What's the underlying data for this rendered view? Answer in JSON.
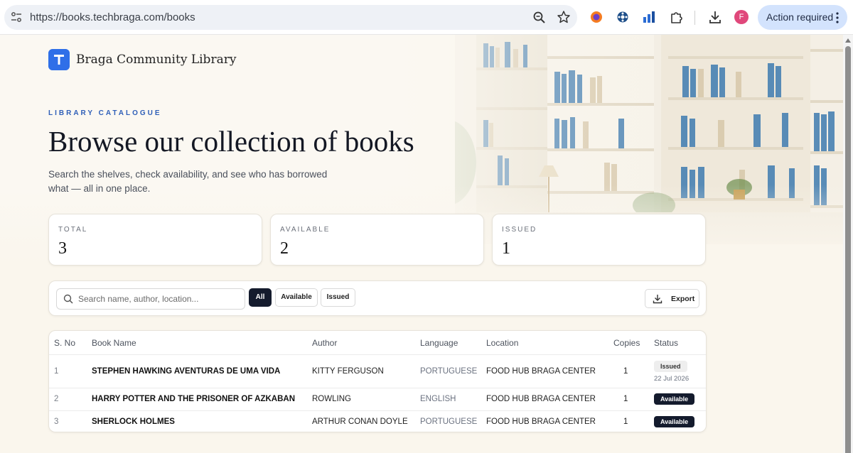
{
  "browser": {
    "url": "https://books.techbraga.com/books",
    "action_required": "Action required",
    "profile_initial": "F"
  },
  "brand": {
    "name": "Braga Community Library"
  },
  "hero": {
    "eyebrow": "LIBRARY CATALOGUE",
    "title": "Browse our collection of books",
    "subtitle": "Search the shelves, check availability, and see who has borrowed what — all in one place."
  },
  "stats": [
    {
      "label": "TOTAL",
      "value": "3"
    },
    {
      "label": "AVAILABLE",
      "value": "2"
    },
    {
      "label": "ISSUED",
      "value": "1"
    }
  ],
  "toolbar": {
    "search_placeholder": "Search name, author, location...",
    "filters": [
      "All",
      "Available",
      "Issued"
    ],
    "active_filter": "All",
    "export_label": "Export"
  },
  "table": {
    "headers": [
      "S. No",
      "Book Name",
      "Author",
      "Language",
      "Location",
      "Copies",
      "Status"
    ],
    "rows": [
      {
        "sno": "1",
        "book": "STEPHEN HAWKING AVENTURAS DE UMA VIDA",
        "author": "KITTY FERGUSON",
        "language": "PORTUGUESE",
        "location": "FOOD HUB BRAGA CENTER",
        "copies": "1",
        "status": "Issued",
        "date": "22 Jul 2026"
      },
      {
        "sno": "2",
        "book": "HARRY POTTER AND THE PRISONER OF AZKABAN",
        "author": "ROWLING",
        "language": "ENGLISH",
        "location": "FOOD HUB BRAGA CENTER",
        "copies": "1",
        "status": "Available"
      },
      {
        "sno": "3",
        "book": "SHERLOCK HOLMES",
        "author": "ARTHUR CONAN DOYLE",
        "language": "PORTUGUESE",
        "location": "FOOD HUB BRAGA CENTER",
        "copies": "1",
        "status": "Available"
      }
    ]
  },
  "colors": {
    "accent": "#2f6fe8",
    "dark": "#141b2d",
    "background": "#fbf7ee"
  }
}
